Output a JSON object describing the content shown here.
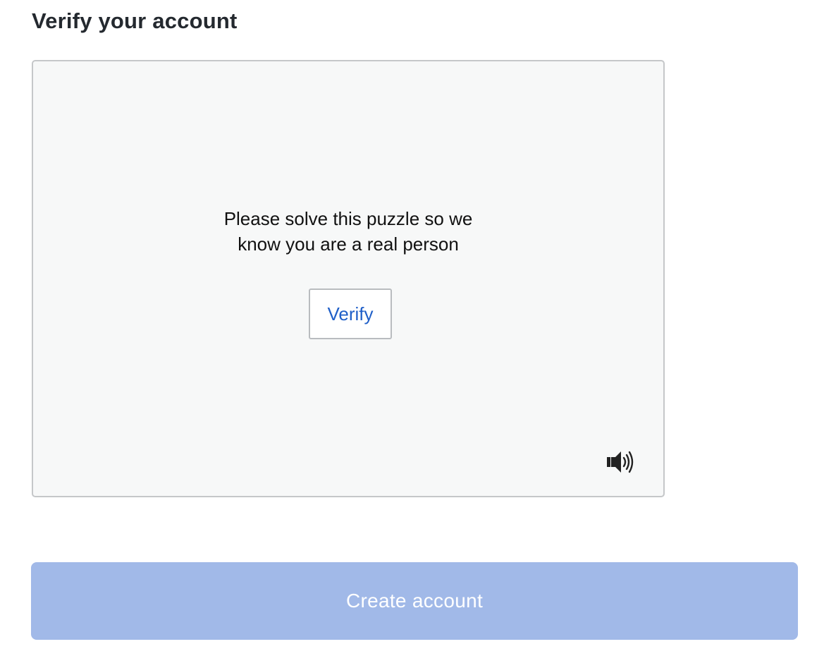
{
  "page": {
    "title": "Verify your account"
  },
  "puzzle": {
    "prompt": "Please solve this puzzle so we know you are a real person",
    "verify_label": "Verify",
    "audio_icon": "speaker-icon"
  },
  "actions": {
    "create_account_label": "Create account",
    "create_account_enabled": false
  },
  "colors": {
    "link_blue": "#1f5fc8",
    "disabled_button_bg": "#a1b9e8",
    "puzzle_bg": "#f7f8f8"
  }
}
